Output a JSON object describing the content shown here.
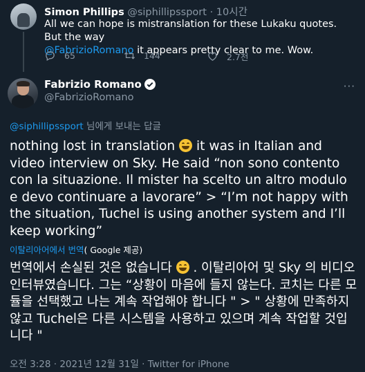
{
  "tweet1": {
    "name": "Simon Phillips",
    "handle": "@siphillipssport",
    "sep": "·",
    "time": "10시간",
    "body_prefix": "All we can hope is mistranslation for these Lukaku quotes. But the way",
    "mention": "@FabrizioRomano",
    "body_suffix": " it appears pretty clear to me. Wow.",
    "reply_count": "65",
    "retweet_count": "144",
    "like_count": "2.7천"
  },
  "tweet2": {
    "name": "Fabrizio Romano",
    "handle": "@FabrizioRomano",
    "more_label": "···",
    "reply_mention": "@siphillipssport",
    "reply_suffix": " 님에게 보내는 답글",
    "text_part1": "nothing lost in translation ",
    "text_part2": " it was in Italian and video interview on Sky. He said “non sono contento con la situazione. Il mister ha scelto un altro modulo e devo continuare a lavorare” > “I’m not happy with the situation, Tuchel is using another system and I’ll keep working”",
    "translate_label": "이탈리아어에서 번역",
    "translate_by": "( Google 제공)",
    "translation_part1": "번역에서 손실된 것은 없습니다 ",
    "translation_part2": " . 이탈리아어 및 Sky 의 비디오 인터뷰였습니다. 그는 “상황이 마음에 들지 않는다. 코치는 다른 모듈을 선택했고 나는 계속 작업해야 합니다 \" > \" 상황에 만족하지 않고 Tuchel은 다른 시스템을 사용하고 있으며 계속 작업할 것입니다 \"",
    "meta": "오전 3:28 · 2021년 12월 31일 · Twitter for iPhone"
  },
  "colors": {
    "background": "#15202b",
    "link": "#1d9bf0",
    "secondary_text": "#8b98a5"
  },
  "icons": [
    "reply-icon",
    "retweet-icon",
    "like-icon",
    "verified-badge-icon",
    "more-icon"
  ]
}
